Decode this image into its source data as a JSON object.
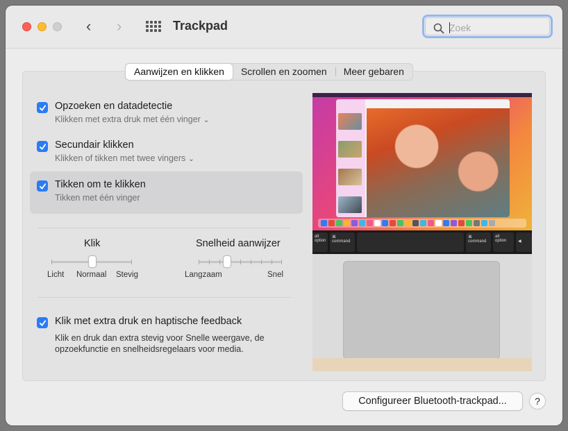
{
  "window": {
    "title": "Trackpad",
    "back_glyph": "‹",
    "forward_glyph": "›"
  },
  "search": {
    "placeholder": "Zoek",
    "value": ""
  },
  "tabs": [
    {
      "label": "Aanwijzen en klikken",
      "active": true
    },
    {
      "label": "Scrollen en zoomen",
      "active": false
    },
    {
      "label": "Meer gebaren",
      "active": false
    }
  ],
  "options": [
    {
      "title": "Opzoeken en datadetectie",
      "subtitle": "Klikken met extra druk met één vinger",
      "checked": true,
      "has_menu": true
    },
    {
      "title": "Secundair klikken",
      "subtitle": "Klikken of tikken met twee vingers",
      "checked": true,
      "has_menu": true
    },
    {
      "title": "Tikken om te klikken",
      "subtitle": "Tikken met één vinger",
      "checked": true,
      "has_menu": false,
      "selected": true
    }
  ],
  "click_slider": {
    "title": "Klik",
    "labels": [
      "Licht",
      "Normaal",
      "Stevig"
    ],
    "value": "Normaal"
  },
  "speed_slider": {
    "title": "Snelheid aanwijzer",
    "min_label": "Langzaam",
    "max_label": "Snel",
    "level": 0.4
  },
  "force_click": {
    "title": "Klik met extra druk en haptische feedback",
    "checked": true,
    "description": "Klik en druk dan extra stevig voor Snelle weergave, de opzoekfunctie en snelheidsregelaars voor media."
  },
  "keyboard_keys": {
    "alt_left": "alt",
    "option_left": "option",
    "cmd_left": "⌘",
    "command_left": "command",
    "cmd_right": "⌘",
    "command_right": "command",
    "alt_right": "alt",
    "option_right": "option",
    "arrow": "◀"
  },
  "footer": {
    "bluetooth_button": "Configureer Bluetooth-trackpad...",
    "help": "?"
  },
  "colors": {
    "accent": "#2a7cf6",
    "search_focus": "#94b7ee",
    "close": "#fe5f57",
    "minimize": "#febc2e"
  }
}
